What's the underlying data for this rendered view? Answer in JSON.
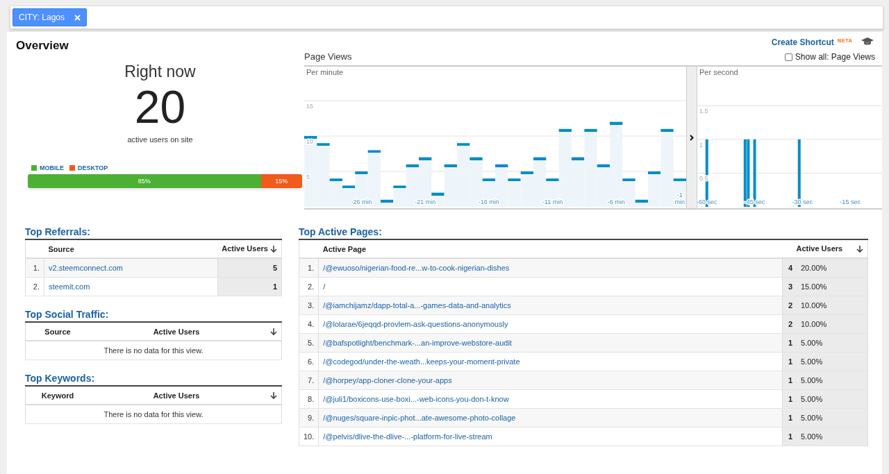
{
  "filter": {
    "label": "CITY: Lagos"
  },
  "title": "Overview",
  "shortcut": {
    "label": "Create Shortcut",
    "badge": "BETA"
  },
  "right_now": {
    "heading": "Right now",
    "count": "20",
    "caption": "active users on site",
    "devices": [
      {
        "label": "MOBILE",
        "color": "#4cb034",
        "level": 0.85,
        "reading": "85%"
      },
      {
        "label": "DESKTOP",
        "color": "#f05a1a",
        "level": 0.15,
        "reading": "15%"
      }
    ]
  },
  "page_views": {
    "title": "Page Views",
    "show_all": {
      "label": "Show all: Page Views",
      "checked": false
    },
    "per_minute": {
      "label": "Per minute",
      "chart_data": {
        "type": "bar",
        "x": [
          -30,
          -29,
          -28,
          -27,
          -26,
          -25,
          -24,
          -23,
          -22,
          -21,
          -20,
          -19,
          -18,
          -17,
          -16,
          -15,
          -14,
          -13,
          -12,
          -11,
          -10,
          -9,
          -8,
          -7,
          -6,
          -5,
          -4,
          -3,
          -2,
          -1
        ],
        "values": [
          10,
          9,
          4,
          3,
          5,
          8,
          1,
          3,
          6,
          7,
          2,
          6,
          9,
          7,
          4,
          6,
          4,
          5,
          7,
          4,
          11,
          7,
          11,
          6,
          12,
          4,
          1,
          5,
          11,
          4
        ],
        "xlim": [
          -30.5,
          -0.5
        ],
        "ylim": [
          0,
          20
        ],
        "yticks": [
          5,
          10,
          15
        ],
        "grid": true,
        "xticks": [
          {
            "value": -26,
            "label": "-26 min"
          },
          {
            "value": -21,
            "label": "-21 min"
          },
          {
            "value": -16,
            "label": "-16 min"
          },
          {
            "value": -11,
            "label": "-11 min"
          },
          {
            "value": -6,
            "label": "-6 min"
          },
          {
            "value": -1,
            "label": "-1 min"
          }
        ]
      }
    },
    "per_second": {
      "label": "Per second",
      "chart_data": {
        "type": "bar",
        "x": [
          -60,
          -48,
          -47,
          -45,
          -31
        ],
        "values": [
          1,
          1,
          1,
          1,
          1
        ],
        "xlim": [
          -63,
          -5
        ],
        "ylim": [
          0,
          2.1
        ],
        "yticks": [
          0.5,
          1,
          1.5
        ],
        "grid": true,
        "xticks": [
          {
            "value": -60,
            "label": "-60 sec"
          },
          {
            "value": -45,
            "label": "-45 sec"
          },
          {
            "value": -30,
            "label": "-30 sec"
          },
          {
            "value": -15,
            "label": "-15 sec"
          }
        ]
      }
    }
  },
  "referrals": {
    "title": "Top Referrals:",
    "columns": [
      "Source",
      "Active Users"
    ],
    "rows": [
      {
        "index": "1.",
        "source": "v2.steemconnect.com",
        "users": "5"
      },
      {
        "index": "2.",
        "source": "steemit.com",
        "users": "1"
      }
    ]
  },
  "social": {
    "title": "Top Social Traffic:",
    "columns": [
      "Source",
      "Active Users"
    ],
    "empty": "There is no data for this view."
  },
  "keywords": {
    "title": "Top Keywords:",
    "columns": [
      "Keyword",
      "Active Users"
    ],
    "empty": "There is no data for this view."
  },
  "active_pages": {
    "title": "Top Active Pages:",
    "columns": [
      "Active Page",
      "Active Users"
    ],
    "rows": [
      {
        "index": "1.",
        "page": "/@ewuoso/nigerian-food-re...w-to-cook-nigerian-dishes",
        "users": "4",
        "share": "20.00%"
      },
      {
        "index": "2.",
        "page": "/",
        "users": "3",
        "share": "15.00%"
      },
      {
        "index": "3.",
        "page": "/@iamchijamz/dapp-total-a...-games-data-and-analytics",
        "users": "2",
        "share": "10.00%"
      },
      {
        "index": "4.",
        "page": "/@lolarae/6jeqqd-provlem-ask-questions-anonymously",
        "users": "2",
        "share": "10.00%"
      },
      {
        "index": "5.",
        "page": "/@bafspotlight/benchmark-...an-improve-webstore-audit",
        "users": "1",
        "share": "5.00%"
      },
      {
        "index": "6.",
        "page": "/@codegod/under-the-weath...keeps-your-moment-private",
        "users": "1",
        "share": "5.00%"
      },
      {
        "index": "7.",
        "page": "/@horpey/app-cloner-clone-your-apps",
        "users": "1",
        "share": "5.00%"
      },
      {
        "index": "8.",
        "page": "/@juli1/boxicons-use-boxi...-web-icons-you-don-t-know",
        "users": "1",
        "share": "5.00%"
      },
      {
        "index": "9.",
        "page": "/@nuges/square-inpic-phot...ate-awesome-photo-collage",
        "users": "1",
        "share": "5.00%"
      },
      {
        "index": "10.",
        "page": "/@pelvis/dlive-the-dlive-...-platform-for-live-stream",
        "users": "1",
        "share": "5.00%"
      }
    ]
  }
}
